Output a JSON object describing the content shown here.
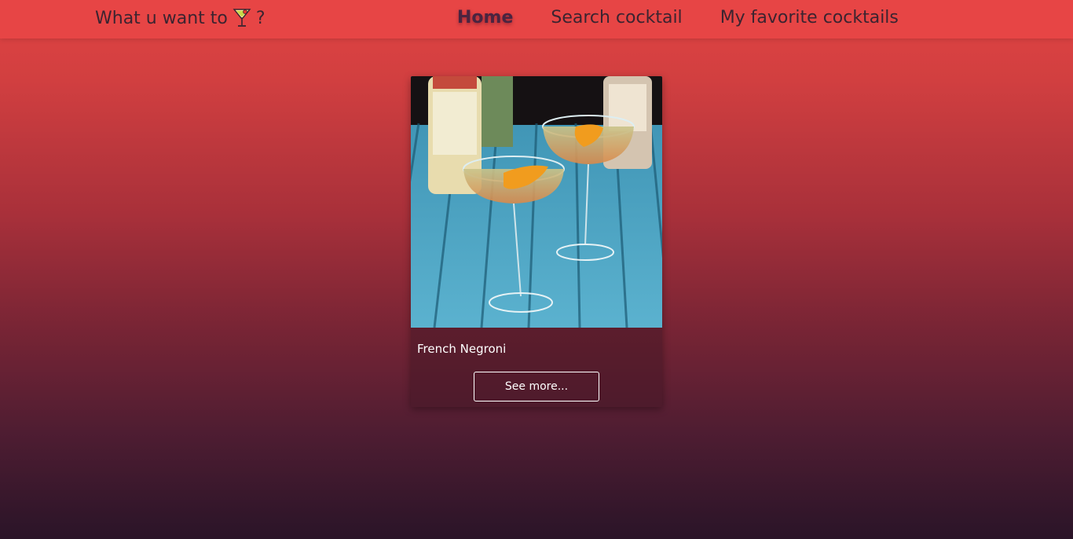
{
  "nav": {
    "brand_prefix": "What u want to",
    "brand_icon": "cocktail-glass-icon",
    "brand_suffix": "?",
    "links": [
      {
        "label": "Home",
        "active": true
      },
      {
        "label": "Search cocktail",
        "active": false
      },
      {
        "label": "My favorite cocktails",
        "active": false
      }
    ]
  },
  "cards": [
    {
      "name": "French Negroni",
      "button_label": "See more..."
    }
  ],
  "colors": {
    "navbar": "#e74545",
    "gradient_top": "#e24443",
    "gradient_bottom": "#2a1428",
    "nav_text": "#3b2430"
  }
}
